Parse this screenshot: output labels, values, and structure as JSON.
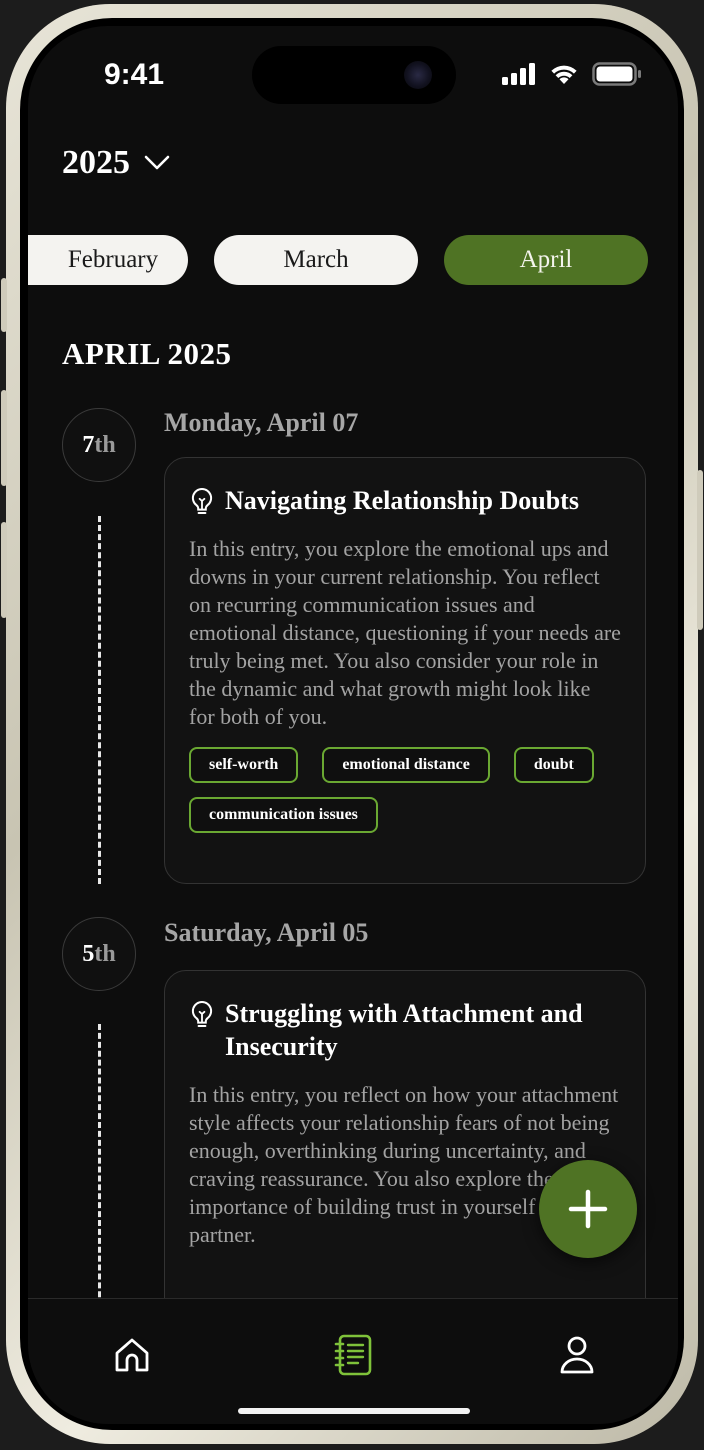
{
  "status_bar": {
    "time": "9:41"
  },
  "year_selector": {
    "year": "2025"
  },
  "months": {
    "items": [
      {
        "label": "February",
        "active": false
      },
      {
        "label": "March",
        "active": false
      },
      {
        "label": "April",
        "active": true
      }
    ]
  },
  "section": {
    "title": "APRIL 2025"
  },
  "entries": [
    {
      "day_num": "7",
      "day_suffix": "th",
      "date_label": "Monday, April 07",
      "title": "Navigating Relationship Doubts",
      "body": "In this entry, you explore the emotional ups and downs in your current relationship. You reflect on recurring communication issues and emotional distance, questioning if your needs are truly being met. You also consider your role in the dynamic and what growth might look like for both of you.",
      "tags": [
        "self-worth",
        "emotional distance",
        "doubt",
        "communication issues"
      ]
    },
    {
      "day_num": "5",
      "day_suffix": "th",
      "date_label": "Saturday, April 05",
      "title": "Struggling with Attachment and Insecurity",
      "body": "In this entry, you reflect on how your attachment style affects your relationship fears of not being enough, overthinking during uncertainty, and craving reassurance. You also explore the importance of building trust in yourself and your partner.",
      "tags": []
    }
  ],
  "icons": {
    "fab": "plus-icon",
    "nav": [
      "home-icon",
      "journal-icon",
      "profile-icon"
    ]
  },
  "colors": {
    "accent": "#4f7324",
    "tag_border": "#6aa832",
    "nav_active": "#7fc23a"
  }
}
